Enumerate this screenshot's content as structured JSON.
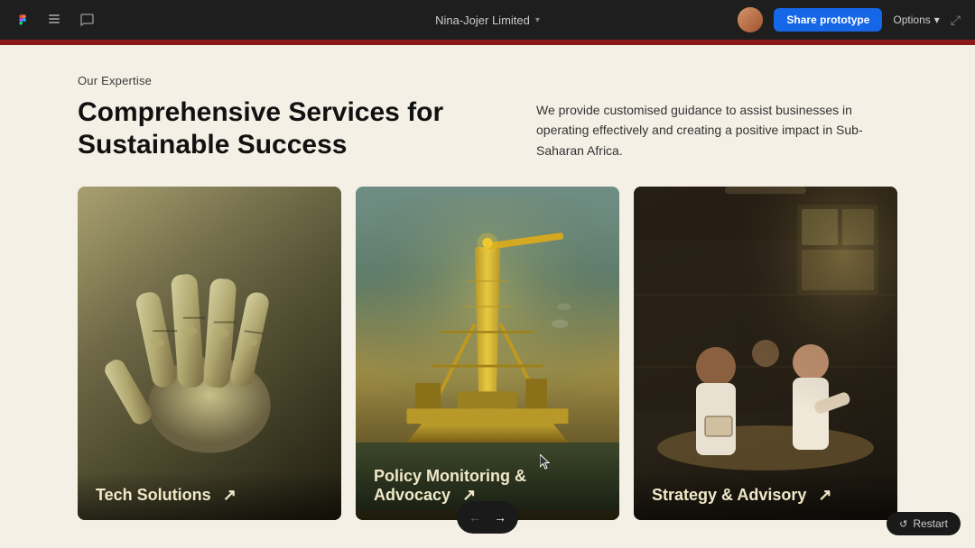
{
  "topbar": {
    "title": "Nina-Jojer Limited",
    "chevron": "▾",
    "share_label": "Share prototype",
    "options_label": "Options",
    "options_chevron": "▾",
    "expand_icon": "⤢"
  },
  "page": {
    "section_label": "Our Expertise",
    "heading_line1": "Comprehensive Services for",
    "heading_line2": "Sustainable Success",
    "description": "We provide customised guidance to assist businesses in operating effectively and creating a positive impact in Sub-Saharan Africa."
  },
  "cards": [
    {
      "title": "Tech Solutions",
      "arrow": "↗",
      "index": 0
    },
    {
      "title": "Policy Monitoring & Advocacy",
      "arrow": "↗",
      "index": 1
    },
    {
      "title": "Strategy & Advisory",
      "arrow": "↗",
      "index": 2
    }
  ],
  "nav": {
    "prev_icon": "←",
    "next_icon": "→"
  },
  "restart": {
    "icon": "↺",
    "label": "Restart"
  }
}
